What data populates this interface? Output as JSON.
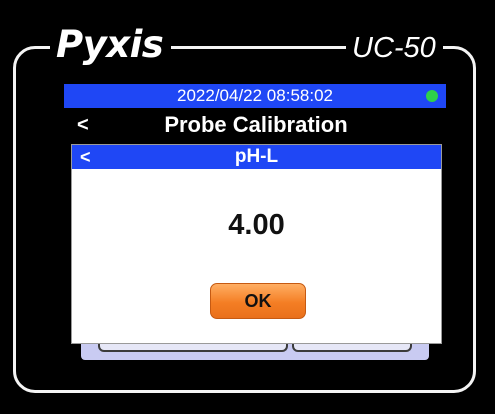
{
  "device": {
    "brand": "Pyxis",
    "model": "UC-50"
  },
  "status_bar": {
    "datetime": "2022/04/22  08:58:02",
    "indicator_color": "#2ed14a",
    "background_color": "#1f47f5"
  },
  "screen": {
    "back_glyph": "<",
    "title": "Probe Calibration"
  },
  "dialog": {
    "back_glyph": "<",
    "title": "pH-L",
    "value": "4.00",
    "ok_label": "OK",
    "ok_color": "#f47e24"
  },
  "icons": {
    "status_indicator": "status-led-icon",
    "back": "back-chevron-icon"
  }
}
